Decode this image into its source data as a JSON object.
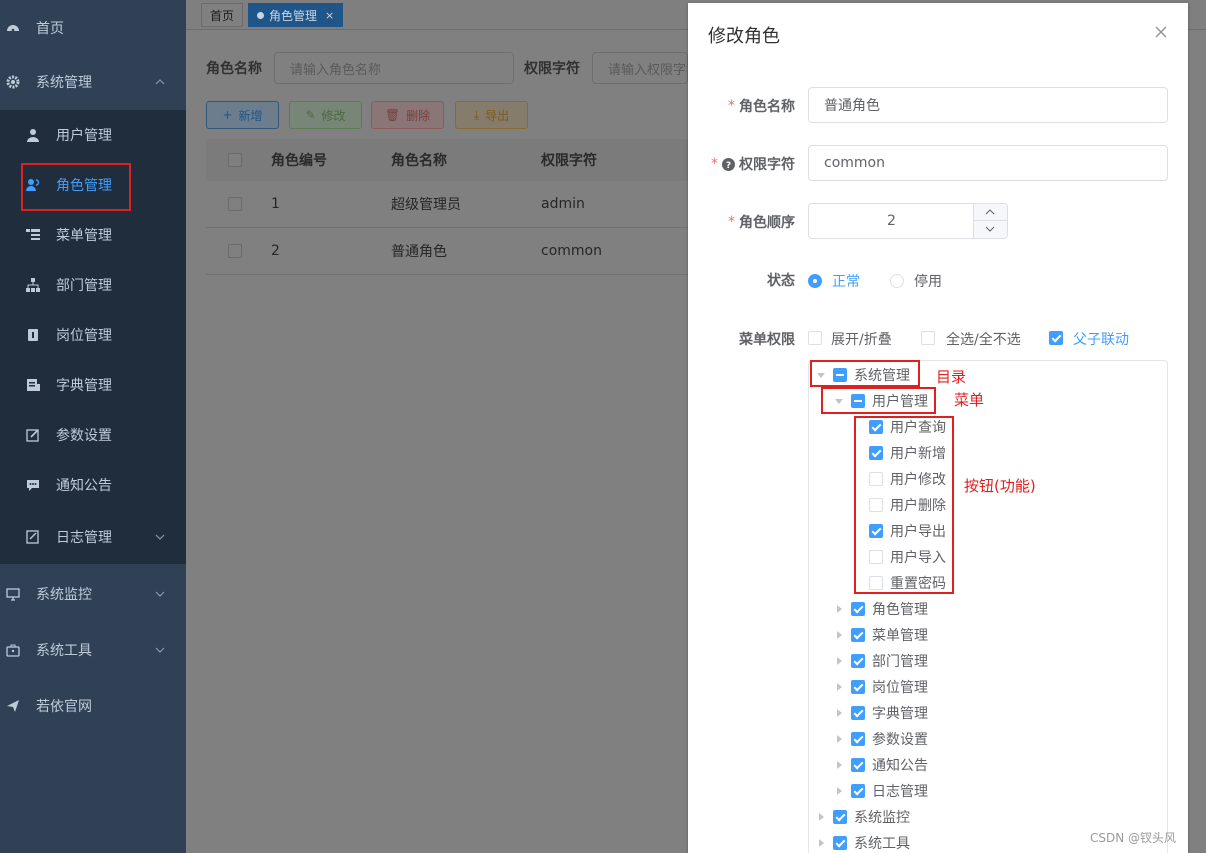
{
  "sidebar": {
    "items": [
      {
        "label": "首页",
        "icon": "dashboard-icon"
      },
      {
        "label": "系统管理",
        "icon": "gear-icon"
      },
      {
        "label": "用户管理",
        "icon": "user-icon"
      },
      {
        "label": "角色管理",
        "icon": "peoples-icon"
      },
      {
        "label": "菜单管理",
        "icon": "tree-table-icon"
      },
      {
        "label": "部门管理",
        "icon": "tree-icon"
      },
      {
        "label": "岗位管理",
        "icon": "post-icon"
      },
      {
        "label": "字典管理",
        "icon": "dict-icon"
      },
      {
        "label": "参数设置",
        "icon": "edit-icon"
      },
      {
        "label": "通知公告",
        "icon": "message-icon"
      },
      {
        "label": "日志管理",
        "icon": "log-icon"
      },
      {
        "label": "系统监控",
        "icon": "monitor-icon"
      },
      {
        "label": "系统工具",
        "icon": "tool-icon"
      },
      {
        "label": "若依官网",
        "icon": "guide-icon"
      }
    ]
  },
  "tags": {
    "home": "首页",
    "current": "角色管理",
    "close": "×"
  },
  "search": {
    "role_name_label": "角色名称",
    "role_name_placeholder": "请输入角色名称",
    "role_key_label": "权限字符",
    "role_key_placeholder": "请输入权限字符"
  },
  "toolbar": {
    "add": "新增",
    "edit": "修改",
    "delete": "删除",
    "export": "导出"
  },
  "table": {
    "headers": [
      "角色编号",
      "角色名称",
      "权限字符"
    ],
    "rows": [
      {
        "id": "1",
        "name": "超级管理员",
        "key": "admin"
      },
      {
        "id": "2",
        "name": "普通角色",
        "key": "common"
      }
    ]
  },
  "dialog": {
    "title": "修改角色",
    "role_name_label": "角色名称",
    "role_name_value": "普通角色",
    "role_key_label": "权限字符",
    "role_key_value": "common",
    "role_sort_label": "角色顺序",
    "role_sort_value": "2",
    "status_label": "状态",
    "status_normal": "正常",
    "status_disabled": "停用",
    "menu_label": "菜单权限",
    "opt_expand": "展开/折叠",
    "opt_select_all": "全选/全不选",
    "opt_linkage": "父子联动",
    "tree": {
      "root": "系统管理",
      "user_menu": "用户管理",
      "buttons": [
        "用户查询",
        "用户新增",
        "用户修改",
        "用户删除",
        "用户导出",
        "用户导入",
        "重置密码"
      ],
      "menus": [
        "角色管理",
        "菜单管理",
        "部门管理",
        "岗位管理",
        "字典管理",
        "参数设置",
        "通知公告",
        "日志管理"
      ],
      "roots_after": [
        "系统监控",
        "系统工具"
      ]
    }
  },
  "annotations": {
    "directory": "目录",
    "menu": "菜单",
    "buttons": "按钮(功能)"
  },
  "watermark": "CSDN @钗头风",
  "colors": {
    "sidebar": "#304156",
    "submenu": "#1f2d3d",
    "primary": "#409eff",
    "annotation": "#e02020"
  }
}
